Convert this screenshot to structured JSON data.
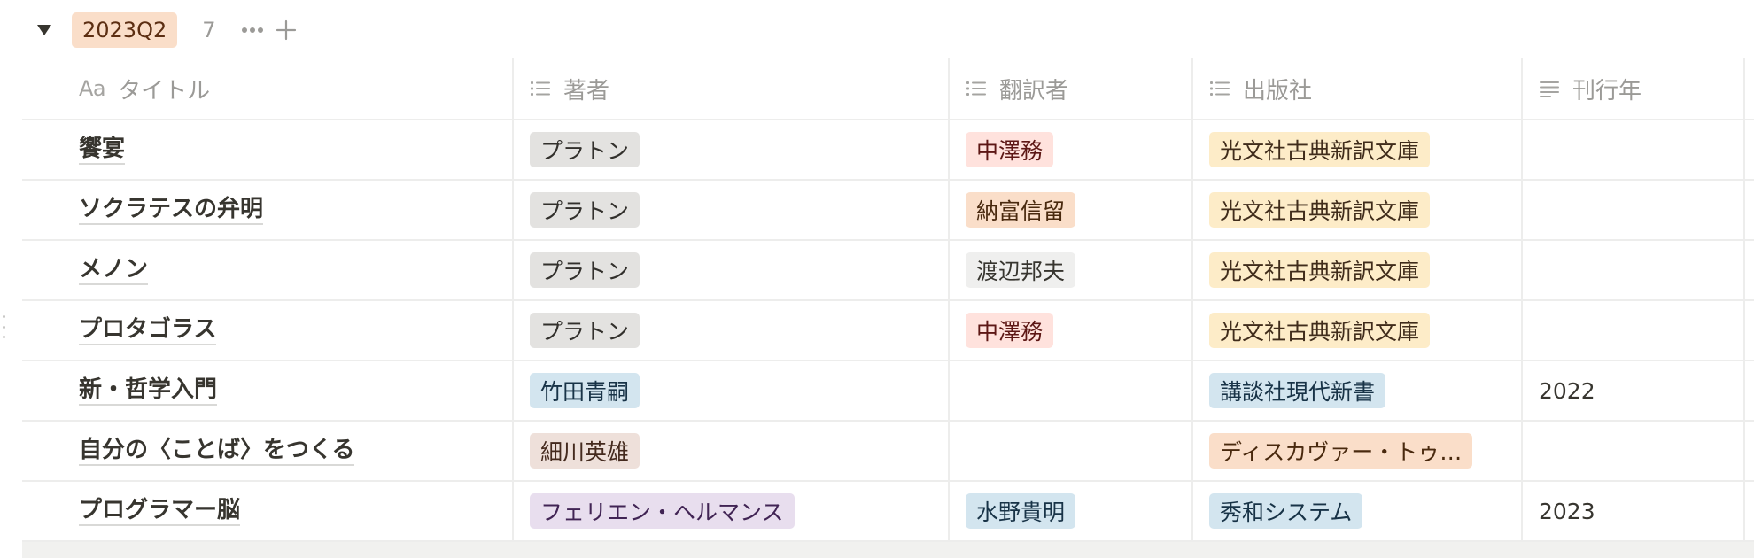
{
  "group": {
    "label": "2023Q2",
    "count": "7"
  },
  "columns": {
    "title_icon": "Aa",
    "title": "タイトル",
    "author": "著者",
    "translator": "翻訳者",
    "publisher": "出版社",
    "year": "刊行年"
  },
  "icons": {
    "toggle": "triangle-down-icon",
    "more": "ellipsis-icon",
    "add": "plus-icon",
    "multiselect": "list-icon",
    "text": "text-lines-icon"
  },
  "rows": [
    {
      "title": "饗宴",
      "author": "プラトン",
      "author_color": "gray",
      "translator": "中澤務",
      "translator_color": "red",
      "publisher": "光文社古典新訳文庫",
      "publisher_color": "yellow",
      "year": ""
    },
    {
      "title": "ソクラテスの弁明",
      "author": "プラトン",
      "author_color": "gray",
      "translator": "納富信留",
      "translator_color": "orange",
      "publisher": "光文社古典新訳文庫",
      "publisher_color": "yellow",
      "year": ""
    },
    {
      "title": "メノン",
      "author": "プラトン",
      "author_color": "gray",
      "translator": "渡辺邦夫",
      "translator_color": "default",
      "publisher": "光文社古典新訳文庫",
      "publisher_color": "yellow",
      "year": ""
    },
    {
      "title": "プロタゴラス",
      "author": "プラトン",
      "author_color": "gray",
      "translator": "中澤務",
      "translator_color": "red",
      "publisher": "光文社古典新訳文庫",
      "publisher_color": "yellow",
      "year": ""
    },
    {
      "title": "新・哲学入門",
      "author": "竹田青嗣",
      "author_color": "blue",
      "translator": "",
      "translator_color": "",
      "publisher": "講談社現代新書",
      "publisher_color": "blue",
      "year": "2022"
    },
    {
      "title": "自分の〈ことば〉をつくる",
      "author": "細川英雄",
      "author_color": "brown",
      "translator": "",
      "translator_color": "",
      "publisher": "ディスカヴァー・トゥ…",
      "publisher_color": "orange",
      "year": ""
    },
    {
      "title": "プログラマー脳",
      "author": "フェリエン・ヘルマンス",
      "author_color": "purple",
      "translator": "水野貴明",
      "translator_color": "blue",
      "publisher": "秀和システム",
      "publisher_color": "blue",
      "year": "2023"
    }
  ]
}
